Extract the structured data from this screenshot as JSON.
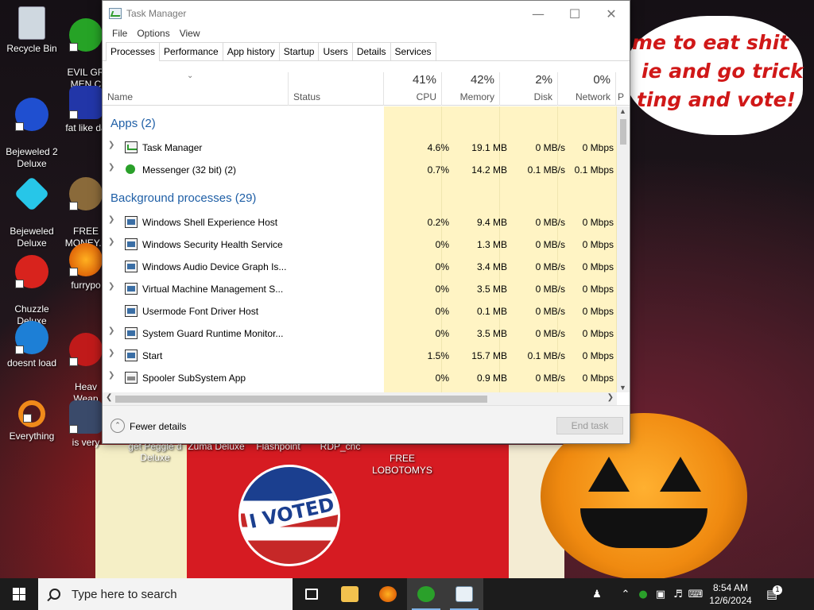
{
  "desktop": {
    "icons": [
      {
        "label": "Recycle Bin"
      },
      {
        "label": "EVIL GR\nMEN C"
      },
      {
        "label": "Bejeweled 2\nDeluxe"
      },
      {
        "label": "fat like da"
      },
      {
        "label": "Bejeweled\nDeluxe"
      },
      {
        "label": "FREE\nMONEY..."
      },
      {
        "label": "Chuzzle\nDeluxe"
      },
      {
        "label": "furrypo"
      },
      {
        "label": "doesnt load"
      },
      {
        "label": "Heav\nWeap"
      },
      {
        "label": "Everything"
      },
      {
        "label": "is very"
      }
    ],
    "bottom_labels": [
      "get Peggle d Deluxe",
      "Zuma Deluxe",
      "Flashpoint",
      "RDP_cnc",
      "FREE\nLOBOTOMYS"
    ],
    "wallpaper_text": [
      "me to eat shit",
      "ie and go trick",
      "ting and vote!"
    ],
    "sticker_text": "I VOTED"
  },
  "window": {
    "title": "Task Manager",
    "menu": [
      "File",
      "Options",
      "View"
    ],
    "tabs": [
      "Processes",
      "Performance",
      "App history",
      "Startup",
      "Users",
      "Details",
      "Services"
    ],
    "active_tab": "Processes",
    "columns": {
      "name": "Name",
      "status": "Status",
      "cpu": {
        "pct": "41%",
        "label": "CPU"
      },
      "memory": {
        "pct": "42%",
        "label": "Memory"
      },
      "disk": {
        "pct": "2%",
        "label": "Disk"
      },
      "network": {
        "pct": "0%",
        "label": "Network"
      },
      "extra": "P"
    },
    "groups": {
      "apps": "Apps (2)",
      "background": "Background processes (29)"
    },
    "apps": [
      {
        "name": "Task Manager",
        "cpu": "4.6%",
        "memory": "19.1 MB",
        "disk": "0 MB/s",
        "network": "0 Mbps",
        "icon": "task-manager-icon"
      },
      {
        "name": "Messenger (32 bit) (2)",
        "cpu": "0.7%",
        "memory": "14.2 MB",
        "disk": "0.1 MB/s",
        "network": "0.1 Mbps",
        "icon": "messenger-icon"
      }
    ],
    "background": [
      {
        "name": "Windows Shell Experience Host",
        "cpu": "0.2%",
        "memory": "9.4 MB",
        "disk": "0 MB/s",
        "network": "0 Mbps"
      },
      {
        "name": "Windows Security Health Service",
        "cpu": "0%",
        "memory": "1.3 MB",
        "disk": "0 MB/s",
        "network": "0 Mbps"
      },
      {
        "name": "Windows Audio Device Graph Is...",
        "cpu": "0%",
        "memory": "3.4 MB",
        "disk": "0 MB/s",
        "network": "0 Mbps"
      },
      {
        "name": "Virtual Machine Management S...",
        "cpu": "0%",
        "memory": "3.5 MB",
        "disk": "0 MB/s",
        "network": "0 Mbps"
      },
      {
        "name": "Usermode Font Driver Host",
        "cpu": "0%",
        "memory": "0.1 MB",
        "disk": "0 MB/s",
        "network": "0 Mbps"
      },
      {
        "name": "System Guard Runtime Monitor...",
        "cpu": "0%",
        "memory": "3.5 MB",
        "disk": "0 MB/s",
        "network": "0 Mbps"
      },
      {
        "name": "Start",
        "cpu": "1.5%",
        "memory": "15.7 MB",
        "disk": "0.1 MB/s",
        "network": "0 Mbps"
      },
      {
        "name": "Spooler SubSystem App",
        "cpu": "0%",
        "memory": "0.9 MB",
        "disk": "0 MB/s",
        "network": "0 Mbps"
      }
    ],
    "footer": {
      "fewer_details": "Fewer details",
      "end_task": "End task"
    },
    "heat_color": "#fff4c4"
  },
  "taskbar": {
    "search_placeholder": "Type here to search",
    "time": "8:54 AM",
    "date": "12/6/2024",
    "notification_count": "1"
  }
}
